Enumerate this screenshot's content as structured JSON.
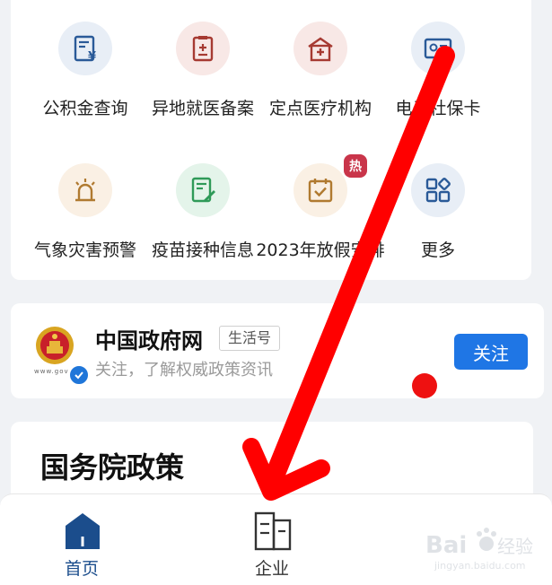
{
  "services": [
    {
      "label": "公积金查询",
      "icon": "fund-bill-icon",
      "icon_bg": "#e8eef6",
      "icon_color": "#2a5a98"
    },
    {
      "label": "异地就医备案",
      "icon": "medical-record-icon",
      "icon_bg": "#f8e8e6",
      "icon_color": "#a63a32"
    },
    {
      "label": "定点医疗机构",
      "icon": "hospital-icon",
      "icon_bg": "#f8e8e6",
      "icon_color": "#a63a32"
    },
    {
      "label": "电子社保卡",
      "icon": "social-security-card-icon",
      "icon_bg": "#e8eef6",
      "icon_color": "#2a5a98"
    },
    {
      "label": "气象灾害预警",
      "icon": "weather-alarm-icon",
      "icon_bg": "#faf0e4",
      "icon_color": "#b07a30"
    },
    {
      "label": "疫苗接种信息",
      "icon": "vaccine-record-icon",
      "icon_bg": "#e4f4ea",
      "icon_color": "#2f9a58"
    },
    {
      "label": "2023年放假安排",
      "icon": "holiday-calendar-icon",
      "icon_bg": "#faf0e4",
      "icon_color": "#b07a30",
      "badge": "热"
    },
    {
      "label": "更多",
      "icon": "more-grid-icon",
      "icon_bg": "#e8eef6",
      "icon_color": "#2a5a98"
    }
  ],
  "account": {
    "name": "中国政府网",
    "tag": "生活号",
    "description": "关注，了解权威政策资讯",
    "emblem_caption": "www.gov",
    "follow_label": "关注"
  },
  "policy": {
    "title": "国务院政策"
  },
  "tabs": [
    {
      "label": "首页",
      "icon": "home-icon",
      "active": true
    },
    {
      "label": "企业",
      "icon": "enterprise-building-icon",
      "active": false
    }
  ],
  "watermark": {
    "brand": "Bai",
    "brand2": "经验",
    "domain": "jingyan.baidu.com"
  },
  "colors": {
    "accent_blue": "#1f76e5",
    "hot_badge": "#c9354a",
    "annotation_red": "#ff0000",
    "tab_active": "#1b4d8c",
    "tab_inactive": "#333333"
  }
}
